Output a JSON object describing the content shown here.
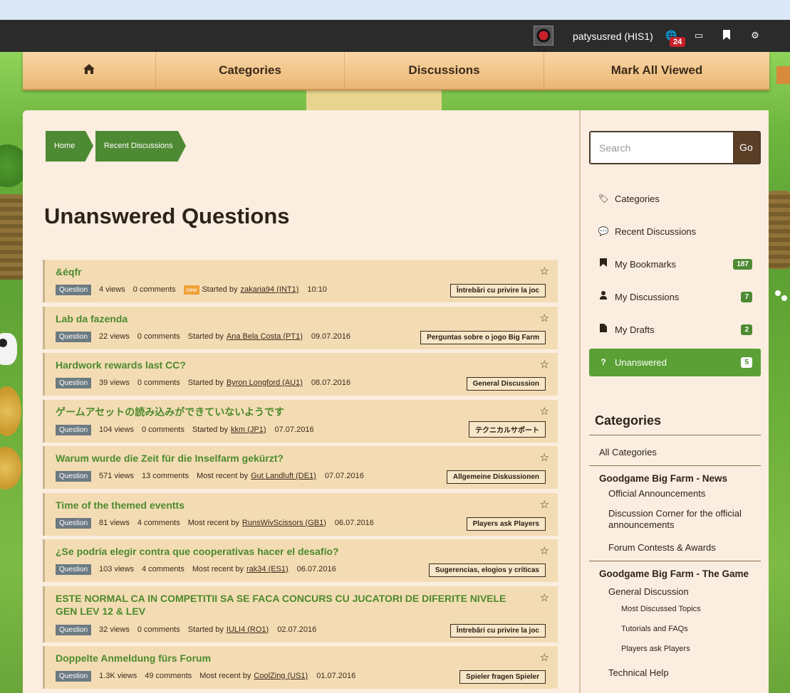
{
  "topbar": {
    "username": "patysusred (HIS1)",
    "notification_count": "24"
  },
  "nav": {
    "categories": "Categories",
    "discussions": "Discussions",
    "mark_all_viewed": "Mark All Viewed"
  },
  "breadcrumb": [
    "Home",
    "Recent Discussions"
  ],
  "page_title": "Unanswered Questions",
  "tag_question": "Question",
  "tag_new": "new",
  "discussions": [
    {
      "title": "&éqfr",
      "views": "4 views",
      "comments": "0 comments",
      "is_new": true,
      "by_label": "Started by",
      "author": "zakaria94 (INT1)",
      "date": "10:10",
      "category": "Întrebări cu privire la joc"
    },
    {
      "title": "Lab da fazenda",
      "views": "22 views",
      "comments": "0 comments",
      "by_label": "Started by",
      "author": "Ana Bela Costa (PT1)",
      "date": "09.07.2016",
      "category": "Perguntas sobre o jogo Big Farm"
    },
    {
      "title": "Hardwork rewards last CC?",
      "views": "39 views",
      "comments": "0 comments",
      "by_label": "Started by",
      "author": "Byron Longford (AU1)",
      "date": "08.07.2016",
      "category": "General Discussion"
    },
    {
      "title": "ゲームアセットの読み込みができていないようです",
      "views": "104 views",
      "comments": "0 comments",
      "by_label": "Started by",
      "author": "kkm (JP1)",
      "date": "07.07.2016",
      "category": "テクニカルサポート"
    },
    {
      "title": "Warum wurde die Zeit für die Inselfarm gekürzt?",
      "views": "571 views",
      "comments": "13 comments",
      "by_label": "Most recent by",
      "author": "Gut Landluft (DE1)",
      "date": "07.07.2016",
      "category": "Allgemeine Diskussionen"
    },
    {
      "title": "Time of the themed eventts",
      "views": "81 views",
      "comments": "4 comments",
      "by_label": "Most recent by",
      "author": "RunsWivScissors (GB1)",
      "date": "06.07.2016",
      "category": "Players ask Players"
    },
    {
      "title": "¿Se podría elegir contra que cooperativas hacer el desafío?",
      "views": "103 views",
      "comments": "4 comments",
      "by_label": "Most recent by",
      "author": "rak34 (ES1)",
      "date": "06.07.2016",
      "category": "Sugerencias, elogios y críticas"
    },
    {
      "title": "ESTE NORMAL CA IN COMPETITII SA SE FACA CONCURS CU JUCATORI DE DIFERITE NIVELE GEN LEV 12 & LEV",
      "views": "32 views",
      "comments": "0 comments",
      "by_label": "Started by",
      "author": "IULI4 (RO1)",
      "date": "02.07.2016",
      "category": "Întrebări cu privire la joc",
      "tall": true
    },
    {
      "title": "Doppelte Anmeldung fürs Forum",
      "views": "1.3K views",
      "comments": "49 comments",
      "by_label": "Most recent by",
      "author": "CoolZing (US1)",
      "date": "01.07.2016",
      "category": "Spieler fragen Spieler"
    }
  ],
  "search": {
    "placeholder": "Search",
    "button": "Go"
  },
  "sidebar": {
    "items": [
      {
        "label": "Categories",
        "icon": "tags-icon"
      },
      {
        "label": "Recent Discussions",
        "icon": "comments-icon"
      },
      {
        "label": "My Bookmarks",
        "icon": "bookmark-icon",
        "count": "187"
      },
      {
        "label": "My Discussions",
        "icon": "user-icon",
        "count": "7"
      },
      {
        "label": "My Drafts",
        "icon": "file-icon",
        "count": "2"
      },
      {
        "label": "Unanswered",
        "icon": "question-icon",
        "count": "5",
        "active": true
      }
    ],
    "categories_heading": "Categories",
    "categories": {
      "all": "All Categories",
      "group1": "Goodgame Big Farm - News",
      "g1_items": [
        "Official Announcements",
        "Discussion Corner for the official announcements",
        "Forum Contests & Awards"
      ],
      "group2": "Goodgame Big Farm - The Game",
      "g2_sub": "General Discussion",
      "g2_subsub": [
        "Most Discussed Topics",
        "Tutorials and FAQs",
        "Players ask Players"
      ],
      "g2_next": "Technical Help"
    }
  },
  "colors": {
    "accent_green": "#4e8a33",
    "title_green": "#4c8a2c",
    "topbar": "#2b2b2b",
    "panel": "#fbeee0"
  }
}
